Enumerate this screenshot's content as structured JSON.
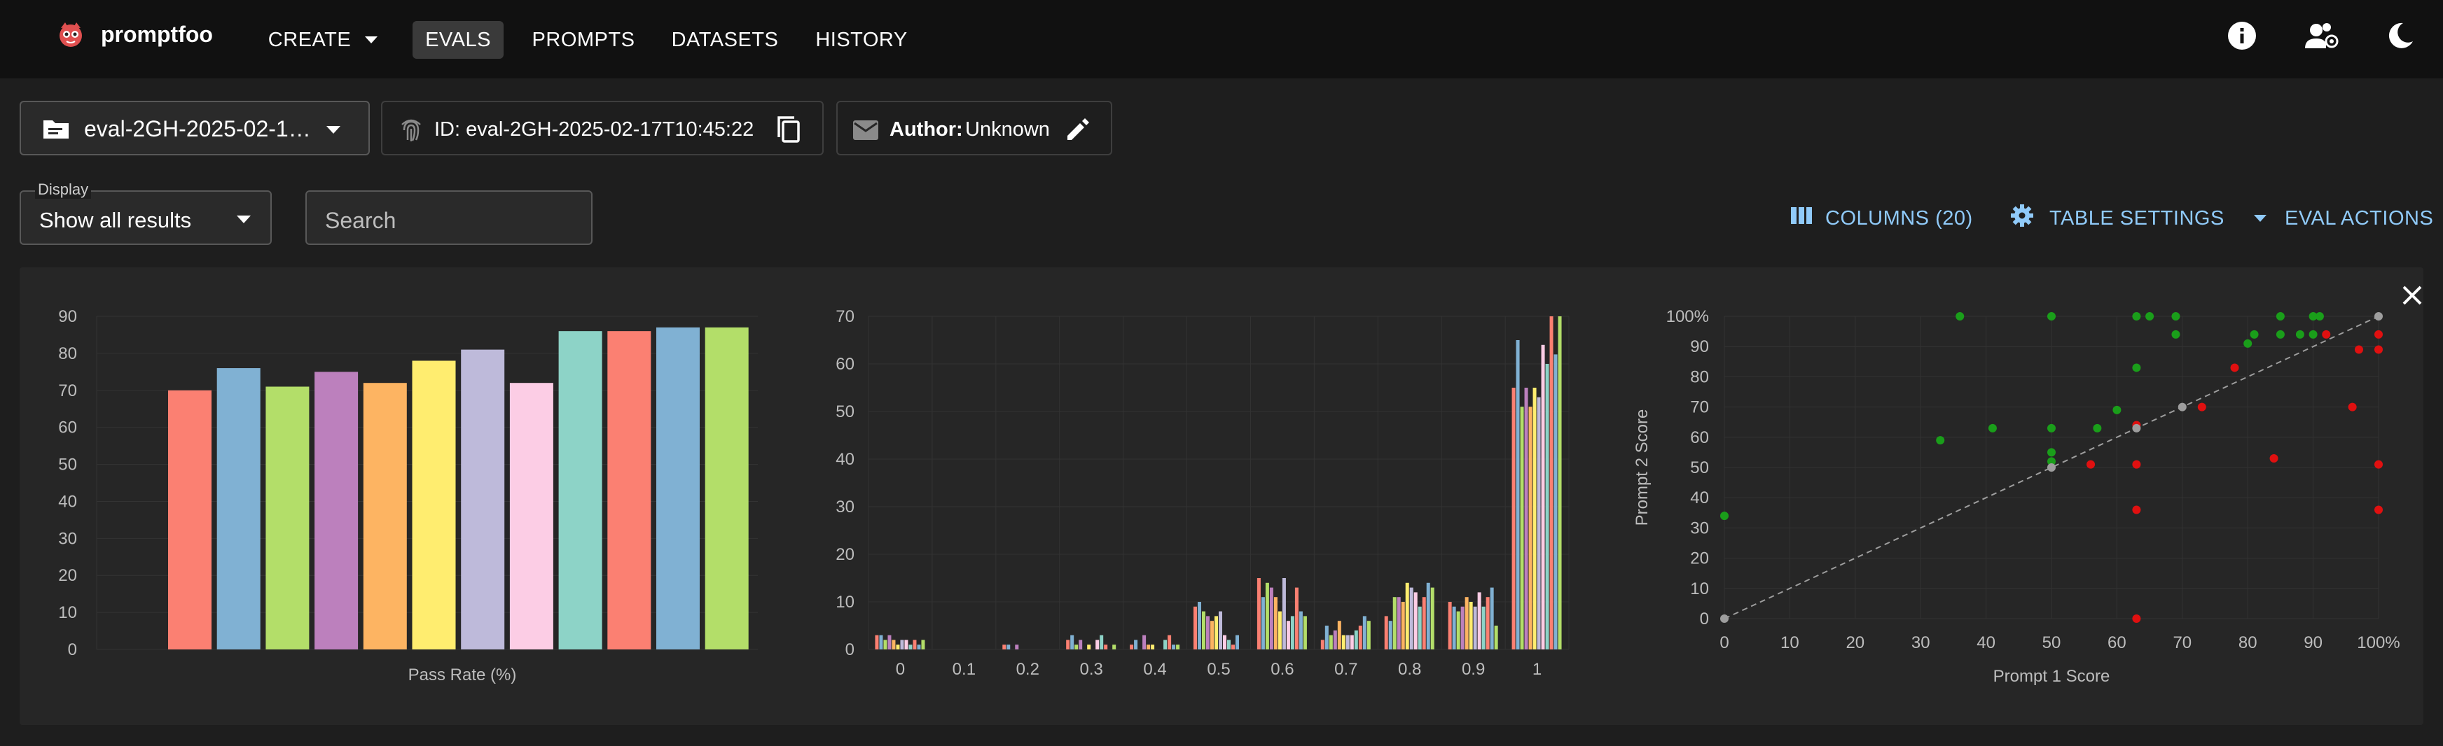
{
  "brand": {
    "name": "promptfoo"
  },
  "nav": {
    "create": "CREATE",
    "evals": "EVALS",
    "prompts": "PROMPTS",
    "datasets": "DATASETS",
    "history": "HISTORY"
  },
  "eval_selector": {
    "value": "eval-2GH-2025-02-1…"
  },
  "eval_id": {
    "text": "ID: eval-2GH-2025-02-17T10:45:22"
  },
  "author": {
    "label": "Author:",
    "value": "Unknown"
  },
  "display": {
    "label": "Display",
    "value": "Show all results"
  },
  "search": {
    "placeholder": "Search"
  },
  "actions": {
    "columns": "COLUMNS (20)",
    "table_settings": "TABLE SETTINGS",
    "eval_actions": "EVAL ACTIONS"
  },
  "colors": {
    "nav_bg": "#111111",
    "page_bg": "#1e1e1e",
    "panel_bg": "#262626",
    "accent": "#90caf9",
    "pass": "#1a9e1a",
    "fail": "#e01010",
    "neutral": "#9e9e9e"
  },
  "chart_data": [
    {
      "type": "bar",
      "xlabel": "Pass Rate (%)",
      "ylim": [
        0,
        90
      ],
      "yticks": [
        0,
        10,
        20,
        30,
        40,
        50,
        60,
        70,
        80,
        90
      ],
      "values": [
        70,
        76,
        71,
        75,
        72,
        78,
        81,
        72,
        86,
        86,
        87,
        87
      ],
      "colors": [
        "#fb8072",
        "#80b1d3",
        "#b3de69",
        "#bc80bd",
        "#fdb462",
        "#ffed6f",
        "#bebada",
        "#fccde5",
        "#8dd3c7",
        "#fb8072",
        "#80b1d3",
        "#b3de69"
      ],
      "grid": true
    },
    {
      "type": "bar",
      "categories": [
        "0",
        "0.1",
        "0.2",
        "0.3",
        "0.4",
        "0.5",
        "0.6",
        "0.7",
        "0.8",
        "0.9",
        "1"
      ],
      "ylim": [
        0,
        70
      ],
      "yticks": [
        0,
        10,
        20,
        30,
        40,
        50,
        60,
        70
      ],
      "colors": [
        "#fb8072",
        "#80b1d3",
        "#b3de69",
        "#bc80bd",
        "#fdb462",
        "#ffed6f",
        "#bebada",
        "#fccde5",
        "#8dd3c7",
        "#fb8072",
        "#80b1d3",
        "#b3de69"
      ],
      "groups": [
        [
          3,
          3,
          2,
          3,
          2,
          1,
          2,
          2,
          1,
          2,
          1,
          2
        ],
        [
          0,
          0,
          0,
          0,
          0,
          0,
          0,
          0,
          0,
          0,
          0,
          0
        ],
        [
          1,
          1,
          0,
          1,
          0,
          0,
          0,
          0,
          0,
          0,
          0,
          0
        ],
        [
          2,
          3,
          1,
          2,
          0,
          1,
          0,
          2,
          3,
          1,
          0,
          1
        ],
        [
          1,
          2,
          0,
          3,
          1,
          1,
          0,
          0,
          2,
          3,
          1,
          1
        ],
        [
          9,
          10,
          8,
          7,
          6,
          7,
          8,
          3,
          2,
          1,
          3,
          0
        ],
        [
          15,
          11,
          14,
          13,
          11,
          8,
          15,
          6,
          7,
          13,
          8,
          7
        ],
        [
          2,
          5,
          3,
          4,
          6,
          3,
          3,
          3,
          4,
          5,
          7,
          6
        ],
        [
          7,
          6,
          11,
          11,
          10,
          14,
          13,
          12,
          9,
          11,
          14,
          13
        ],
        [
          10,
          9,
          8,
          9,
          11,
          10,
          9,
          12,
          9,
          11,
          13,
          5
        ],
        [
          55,
          65,
          51,
          55,
          51,
          55,
          53,
          64,
          60,
          70,
          62,
          70
        ]
      ],
      "grid": true
    },
    {
      "type": "scatter",
      "xlabel": "Prompt 1 Score",
      "ylabel": "Prompt 2 Score",
      "xlim": [
        0,
        100
      ],
      "ylim": [
        0,
        100
      ],
      "xticks": [
        "0",
        "10",
        "20",
        "30",
        "40",
        "50",
        "60",
        "70",
        "80",
        "90",
        "100%"
      ],
      "yticks": [
        "0",
        "10",
        "20",
        "30",
        "40",
        "50",
        "60",
        "70",
        "80",
        "90",
        "100%"
      ],
      "diagonal": true,
      "grid": true,
      "points": [
        {
          "x": 0,
          "y": 34,
          "g": "pass"
        },
        {
          "x": 36,
          "y": 100,
          "g": "pass"
        },
        {
          "x": 50,
          "y": 100,
          "g": "pass"
        },
        {
          "x": 63,
          "y": 100,
          "g": "pass"
        },
        {
          "x": 65,
          "y": 100,
          "g": "pass"
        },
        {
          "x": 69,
          "y": 100,
          "g": "pass"
        },
        {
          "x": 85,
          "y": 100,
          "g": "pass"
        },
        {
          "x": 90,
          "y": 100,
          "g": "pass"
        },
        {
          "x": 91,
          "y": 100,
          "g": "pass"
        },
        {
          "x": 69,
          "y": 94,
          "g": "pass"
        },
        {
          "x": 81,
          "y": 94,
          "g": "pass"
        },
        {
          "x": 85,
          "y": 94,
          "g": "pass"
        },
        {
          "x": 88,
          "y": 94,
          "g": "pass"
        },
        {
          "x": 90,
          "y": 94,
          "g": "pass"
        },
        {
          "x": 80,
          "y": 91,
          "g": "pass"
        },
        {
          "x": 63,
          "y": 83,
          "g": "pass"
        },
        {
          "x": 60,
          "y": 69,
          "g": "pass"
        },
        {
          "x": 33,
          "y": 59,
          "g": "pass"
        },
        {
          "x": 41,
          "y": 63,
          "g": "pass"
        },
        {
          "x": 50,
          "y": 63,
          "g": "pass"
        },
        {
          "x": 57,
          "y": 63,
          "g": "pass"
        },
        {
          "x": 50,
          "y": 55,
          "g": "pass"
        },
        {
          "x": 50,
          "y": 52,
          "g": "pass"
        },
        {
          "x": 92,
          "y": 94,
          "g": "fail"
        },
        {
          "x": 100,
          "y": 94,
          "g": "fail"
        },
        {
          "x": 97,
          "y": 89,
          "g": "fail"
        },
        {
          "x": 100,
          "y": 89,
          "g": "fail"
        },
        {
          "x": 78,
          "y": 83,
          "g": "fail"
        },
        {
          "x": 73,
          "y": 70,
          "g": "fail"
        },
        {
          "x": 96,
          "y": 70,
          "g": "fail"
        },
        {
          "x": 63,
          "y": 64,
          "g": "fail"
        },
        {
          "x": 84,
          "y": 53,
          "g": "fail"
        },
        {
          "x": 56,
          "y": 51,
          "g": "fail"
        },
        {
          "x": 63,
          "y": 51,
          "g": "fail"
        },
        {
          "x": 100,
          "y": 51,
          "g": "fail"
        },
        {
          "x": 63,
          "y": 36,
          "g": "fail"
        },
        {
          "x": 100,
          "y": 36,
          "g": "fail"
        },
        {
          "x": 63,
          "y": 0,
          "g": "fail"
        },
        {
          "x": 0,
          "y": 0,
          "g": "neutral"
        },
        {
          "x": 50,
          "y": 50,
          "g": "neutral"
        },
        {
          "x": 63,
          "y": 63,
          "g": "neutral"
        },
        {
          "x": 70,
          "y": 70,
          "g": "neutral"
        },
        {
          "x": 100,
          "y": 100,
          "g": "neutral"
        }
      ]
    }
  ]
}
